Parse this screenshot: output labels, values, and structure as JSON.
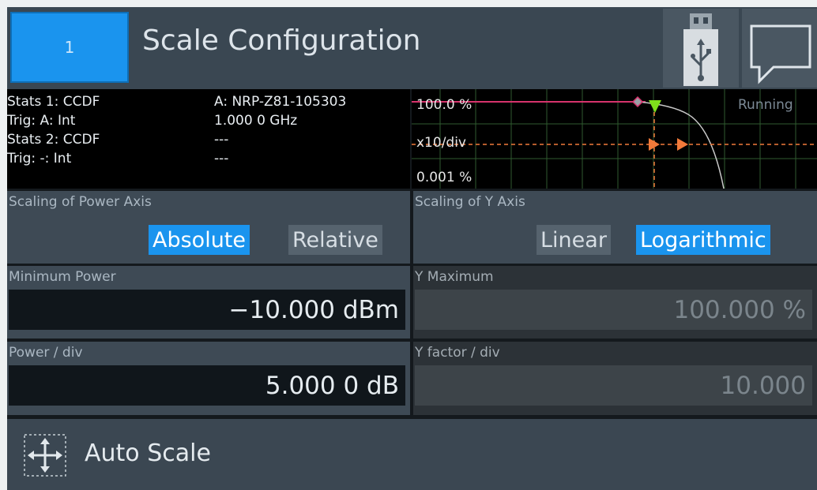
{
  "header": {
    "channel_button": "1",
    "title": "Scale Configuration",
    "usb_icon": "usb-icon",
    "message_icon": "message-icon"
  },
  "status": {
    "stats1": "Stats 1: CCDF",
    "trig1": "Trig: A: Int",
    "stats2": "Stats 2: CCDF",
    "trig2": "Trig: -: Int",
    "sensor": "A: NRP-Z81-105303",
    "frequency": "1.000 0 GHz",
    "dash1": "---",
    "dash2": "---"
  },
  "trace": {
    "top_label": "100.0 %",
    "mid_label": "x10/div",
    "bottom_label": "0.001 %",
    "state": "Running"
  },
  "power_axis": {
    "label": "Scaling of Power Axis",
    "options": [
      "Absolute",
      "Relative"
    ],
    "selected": "Absolute"
  },
  "y_axis": {
    "label": "Scaling of Y Axis",
    "options": [
      "Linear",
      "Logarithmic"
    ],
    "selected": "Logarithmic"
  },
  "minimum_power": {
    "label": "Minimum Power",
    "value": "−10.000  dBm"
  },
  "y_maximum": {
    "label": "Y Maximum",
    "value": "100.000  %"
  },
  "power_div": {
    "label": "Power / div",
    "value": "5.000 0  dB"
  },
  "y_factor_div": {
    "label": "Y factor / div",
    "value": "10.000"
  },
  "auto_scale": {
    "label": "Auto Scale",
    "icon": "auto-scale-icon"
  },
  "colors": {
    "accent": "#1a94ee",
    "marker_green": "#7fe01b",
    "marker_orange": "#f27a3a",
    "trace_pink": "#d6336c"
  }
}
